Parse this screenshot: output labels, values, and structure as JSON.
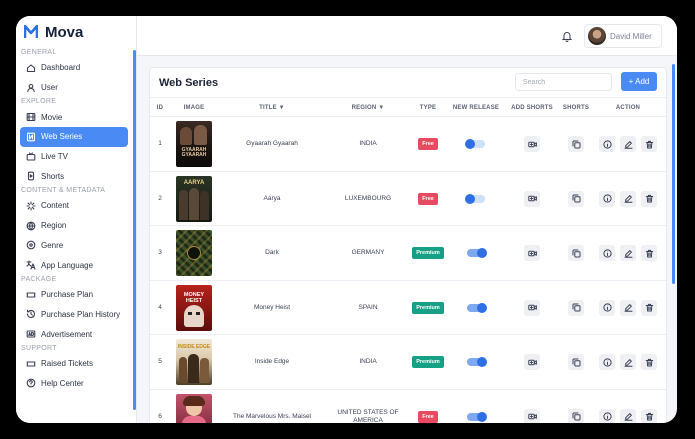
{
  "brand": {
    "name": "Mova"
  },
  "sidebar": {
    "sections": [
      {
        "label": "GENERAL",
        "items": [
          {
            "label": "Dashboard",
            "icon": "home-icon"
          },
          {
            "label": "User",
            "icon": "user-icon"
          }
        ]
      },
      {
        "label": "EXPLORE",
        "items": [
          {
            "label": "Movie",
            "icon": "film-icon"
          },
          {
            "label": "Web Series",
            "icon": "series-icon",
            "active": true
          },
          {
            "label": "Live TV",
            "icon": "tv-icon"
          },
          {
            "label": "Shorts",
            "icon": "shorts-icon"
          }
        ]
      },
      {
        "label": "CONTENT & METADATA",
        "items": [
          {
            "label": "Content",
            "icon": "content-icon"
          },
          {
            "label": "Region",
            "icon": "globe-icon"
          },
          {
            "label": "Genre",
            "icon": "genre-icon"
          },
          {
            "label": "App Language",
            "icon": "translate-icon"
          }
        ]
      },
      {
        "label": "PACKAGE",
        "items": [
          {
            "label": "Purchase Plan",
            "icon": "ticket-icon"
          },
          {
            "label": "Purchase Plan History",
            "icon": "history-icon"
          },
          {
            "label": "Advertisement",
            "icon": "ad-icon"
          }
        ]
      },
      {
        "label": "SUPPORT",
        "items": [
          {
            "label": "Raised Tickets",
            "icon": "ticket-icon"
          },
          {
            "label": "Help Center",
            "icon": "help-icon"
          }
        ]
      }
    ]
  },
  "header": {
    "user_name": "David Miller"
  },
  "page": {
    "title": "Web Series",
    "search_placeholder": "Search",
    "add_label": "+ Add"
  },
  "table": {
    "columns": [
      "ID",
      "IMAGE",
      "TITLE ▼",
      "REGION ▼",
      "TYPE",
      "NEW RELEASE",
      "ADD SHORTS",
      "SHORTS",
      "ACTION"
    ],
    "rows": [
      {
        "id": "1",
        "title": "Gyaarah Gyaarah",
        "region": "INDIA",
        "type": "Free",
        "new_release": false,
        "poster": "gyaarah-poster"
      },
      {
        "id": "2",
        "title": "Aarya",
        "region": "LUXEMBOURG",
        "type": "Free",
        "new_release": false,
        "poster": "aarya-poster"
      },
      {
        "id": "3",
        "title": "Dark",
        "region": "GERMANY",
        "type": "Premium",
        "new_release": true,
        "poster": "dark-poster"
      },
      {
        "id": "4",
        "title": "Money Heist",
        "region": "SPAIN",
        "type": "Premium",
        "new_release": true,
        "poster": "money-heist-poster"
      },
      {
        "id": "5",
        "title": "Inside Edge",
        "region": "INDIA",
        "type": "Premium",
        "new_release": true,
        "poster": "inside-edge-poster"
      },
      {
        "id": "6",
        "title": "The Marvelous Mrs. Maisel",
        "region": "UNITED STATES OF AMERICA",
        "type": "Free",
        "new_release": true,
        "poster": "maisel-poster"
      }
    ]
  },
  "poster_text": {
    "gyaarah": "GYAARAH GYAARAH",
    "aarya": "AARYA",
    "money": "MONEY HEIST",
    "inside": "INSIDE EDGE"
  },
  "colors": {
    "accent": "#4a8af4",
    "free": "#e84a5f",
    "premium": "#16a085"
  }
}
